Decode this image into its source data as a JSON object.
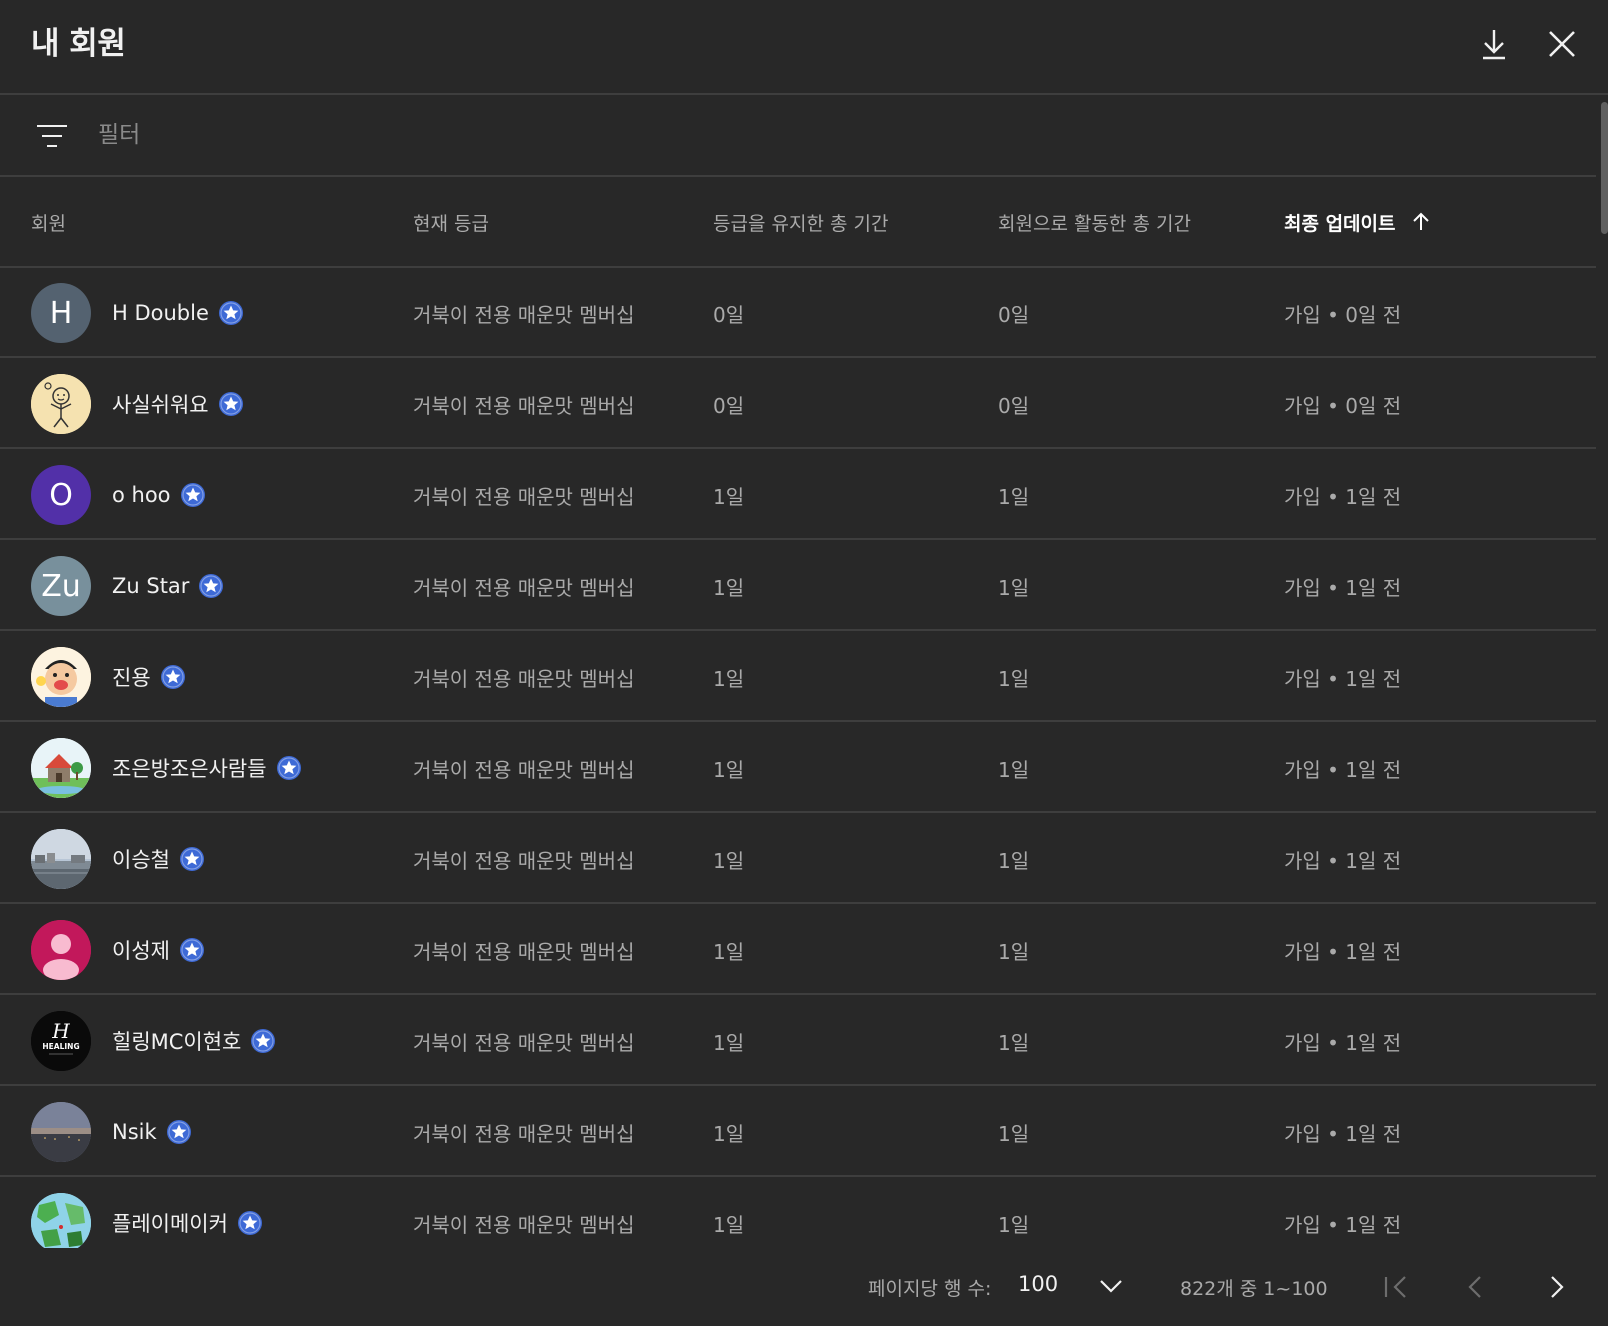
{
  "header": {
    "title": "내 회원",
    "download_icon": "download-icon",
    "close_icon": "close-icon"
  },
  "filter": {
    "icon": "filter-icon",
    "placeholder": "필터",
    "value": ""
  },
  "table": {
    "columns": [
      {
        "label": "회원"
      },
      {
        "label": "현재 등급"
      },
      {
        "label": "등급을 유지한 총 기간"
      },
      {
        "label": "회원으로 활동한 총 기간"
      },
      {
        "label": "최종 업데이트",
        "sorted": "ascending",
        "sort_icon": "arrow-up-icon"
      }
    ],
    "rows": [
      {
        "name": "H Double",
        "avatar_initial": "H",
        "avatar_color": "#546270",
        "avatar_type": "letter",
        "level": "거북이 전용 매운맛 멤버십",
        "level_duration": "0일",
        "member_duration": "0일",
        "update": "가입 • 0일 전"
      },
      {
        "name": "사실쉬워요",
        "avatar_initial": "",
        "avatar_color": "#f5e2b0",
        "avatar_type": "image-doodle",
        "level": "거북이 전용 매운맛 멤버십",
        "level_duration": "0일",
        "member_duration": "0일",
        "update": "가입 • 0일 전"
      },
      {
        "name": "o hoo",
        "avatar_initial": "O",
        "avatar_color": "#5230a8",
        "avatar_type": "letter",
        "level": "거북이 전용 매운맛 멤버십",
        "level_duration": "1일",
        "member_duration": "1일",
        "update": "가입 • 1일 전"
      },
      {
        "name": "Zu Star",
        "avatar_initial": "Zu",
        "avatar_color": "#78909c",
        "avatar_type": "letter",
        "level": "거북이 전용 매운맛 멤버십",
        "level_duration": "1일",
        "member_duration": "1일",
        "update": "가입 • 1일 전"
      },
      {
        "name": "진용",
        "avatar_initial": "",
        "avatar_color": "#f7d8a8",
        "avatar_type": "image-cartoon",
        "level": "거북이 전용 매운맛 멤버십",
        "level_duration": "1일",
        "member_duration": "1일",
        "update": "가입 • 1일 전"
      },
      {
        "name": "조은방조은사람들",
        "avatar_initial": "",
        "avatar_color": "#e8f4f8",
        "avatar_type": "image-house",
        "level": "거북이 전용 매운맛 멤버십",
        "level_duration": "1일",
        "member_duration": "1일",
        "update": "가입 • 1일 전"
      },
      {
        "name": "이승철",
        "avatar_initial": "",
        "avatar_color": "#9fb3c8",
        "avatar_type": "image-landscape",
        "level": "거북이 전용 매운맛 멤버십",
        "level_duration": "1일",
        "member_duration": "1일",
        "update": "가입 • 1일 전"
      },
      {
        "name": "이성제",
        "avatar_initial": "",
        "avatar_color": "#c2185b",
        "avatar_type": "image-person",
        "level": "거북이 전용 매운맛 멤버십",
        "level_duration": "1일",
        "member_duration": "1일",
        "update": "가입 • 1일 전"
      },
      {
        "name": "힐링MC이현호",
        "avatar_initial": "",
        "avatar_color": "#0a0a0a",
        "avatar_type": "image-logo",
        "avatar_text": "HEALING",
        "level": "거북이 전용 매운맛 멤버십",
        "level_duration": "1일",
        "member_duration": "1일",
        "update": "가입 • 1일 전"
      },
      {
        "name": "Nsik",
        "avatar_initial": "",
        "avatar_color": "#6b7080",
        "avatar_type": "image-dusk",
        "level": "거북이 전용 매운맛 멤버십",
        "level_duration": "1일",
        "member_duration": "1일",
        "update": "가입 • 1일 전"
      },
      {
        "name": "플레이메이커",
        "avatar_initial": "",
        "avatar_color": "#8fd3e8",
        "avatar_type": "image-map",
        "level": "거북이 전용 매운맛 멤버십",
        "level_duration": "1일",
        "member_duration": "1일",
        "update": "가입 • 1일 전"
      }
    ],
    "badge_icon": "member-star-badge-icon",
    "badge_color": "#3e6ad6"
  },
  "footer": {
    "rows_per_page_label": "페이지당 행 수:",
    "rows_per_page_value": "100",
    "range_text": "822개 중 1~100",
    "first_page_icon": "first-page-icon",
    "prev_page_icon": "chevron-left-icon",
    "next_page_icon": "chevron-right-icon"
  },
  "colors": {
    "background": "#282828",
    "divider": "#3e3e3e",
    "text_primary": "#f1f1f1",
    "text_secondary": "#aaaaaa"
  }
}
